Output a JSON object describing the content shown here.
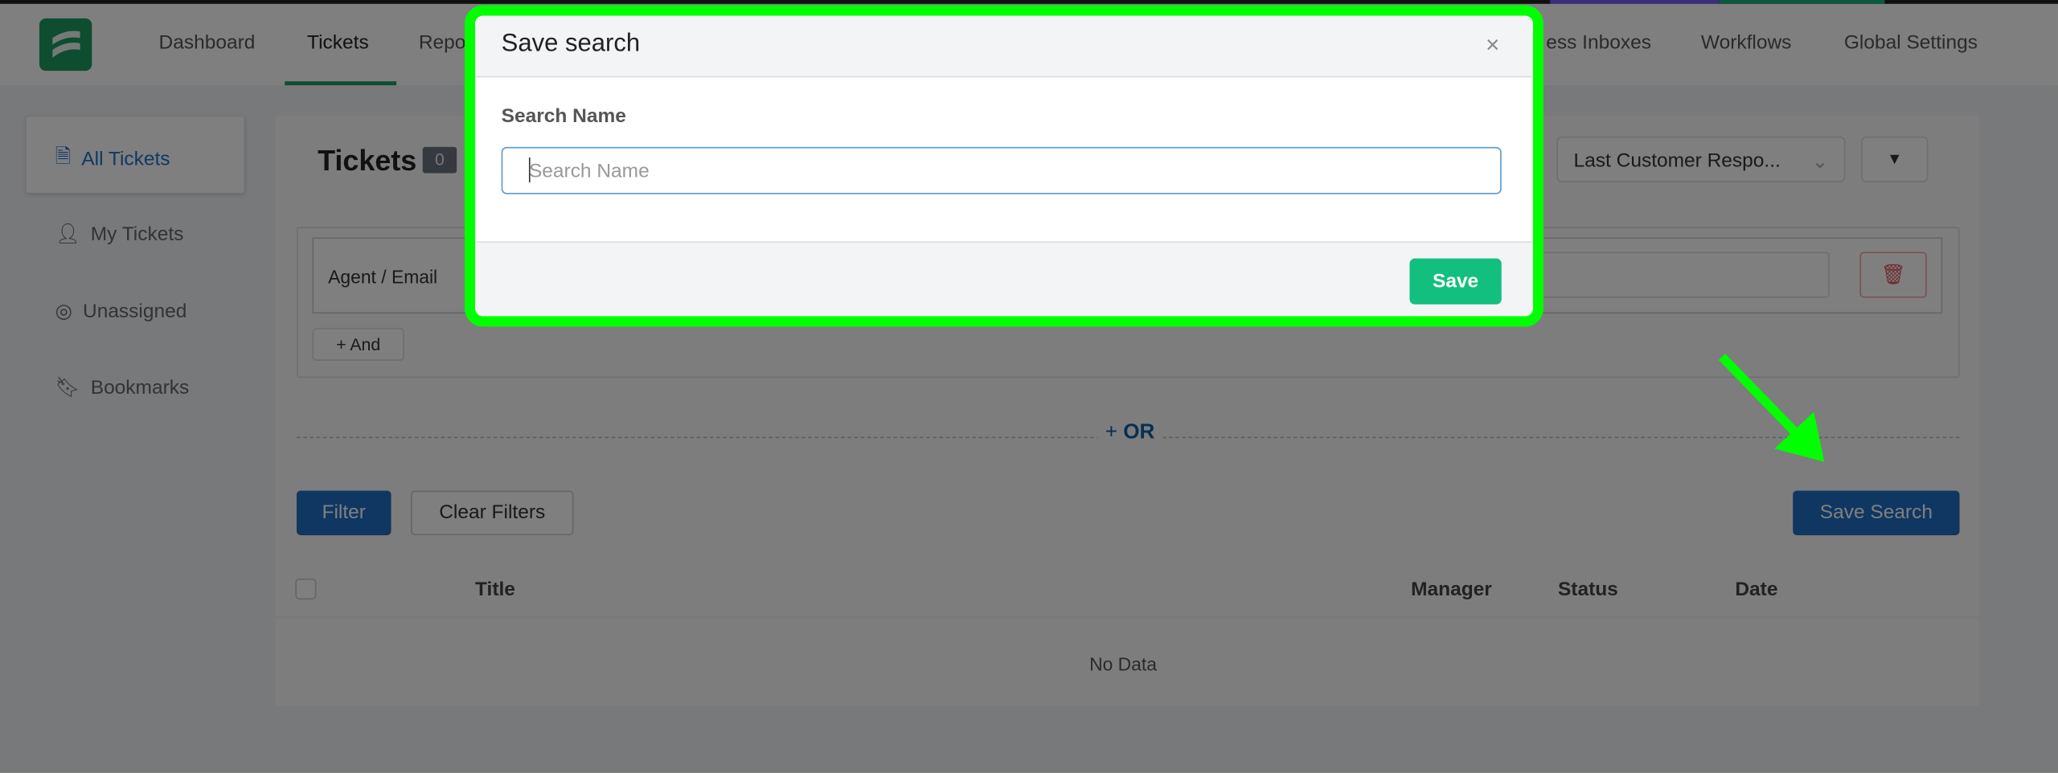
{
  "header": {
    "nav": [
      {
        "label": "Dashboard"
      },
      {
        "label": "Tickets",
        "active": true
      },
      {
        "label": "Repo"
      },
      {
        "label": "ess Inboxes"
      },
      {
        "label": "Workflows"
      },
      {
        "label": "Global Settings"
      }
    ]
  },
  "sidebar": {
    "items": [
      {
        "label": "All Tickets",
        "icon": "document-icon",
        "active": true
      },
      {
        "label": "My Tickets",
        "icon": "user-icon"
      },
      {
        "label": "Unassigned",
        "icon": "eye-icon"
      },
      {
        "label": "Bookmarks",
        "icon": "bookmark-icon"
      }
    ]
  },
  "main": {
    "title": "Tickets",
    "count": "0",
    "sort_select": "Last Customer Respo...",
    "sort_dir_icon": "▼",
    "filter": {
      "field": "Agent / Email",
      "and_label": "+ And",
      "or_label": "OR"
    },
    "buttons": {
      "filter": "Filter",
      "clear": "Clear Filters",
      "save_search": "Save Search"
    },
    "table": {
      "columns": [
        "Title",
        "Manager",
        "Status",
        "Date"
      ],
      "empty": "No Data"
    }
  },
  "modal": {
    "title": "Save search",
    "close": "×",
    "label": "Search Name",
    "placeholder": "Search Name",
    "value": "",
    "save": "Save"
  },
  "colors": {
    "accent_green": "#13bf7e",
    "brand_green": "#1d9a60",
    "primary_blue": "#1e6fc4",
    "highlight": "#00ff00"
  }
}
